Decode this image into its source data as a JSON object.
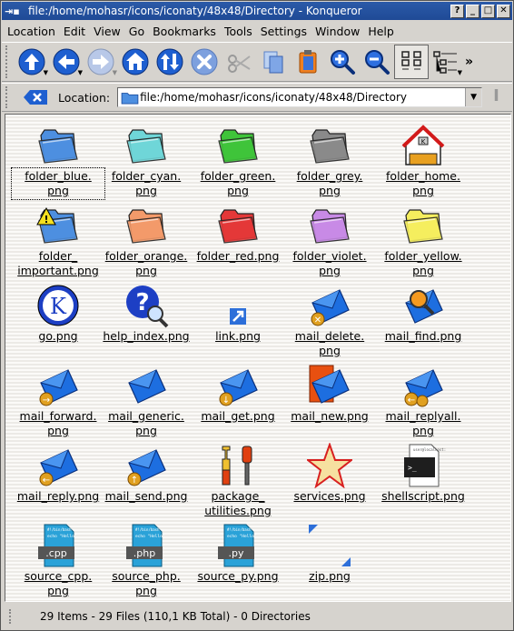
{
  "window": {
    "title": "file:/home/mohasr/icons/iconaty/48x48/Directory - Konqueror",
    "app_icon": "konqueror-icon",
    "buttons": [
      "?",
      "_",
      "□",
      "✕"
    ]
  },
  "menu": [
    "Location",
    "Edit",
    "View",
    "Go",
    "Bookmarks",
    "Tools",
    "Settings",
    "Window",
    "Help"
  ],
  "toolbar": {
    "buttons": [
      "up-arrow-icon",
      "back-arrow-icon",
      "forward-arrow-icon",
      "home-icon",
      "reload-icon",
      "stop-icon",
      "cut-icon",
      "copy-icon",
      "paste-icon",
      "zoom-in-icon",
      "zoom-out-icon",
      "icon-view-icon",
      "tree-view-icon"
    ],
    "more": "»"
  },
  "locationbar": {
    "label": "Location:",
    "url": "file:/home/mohasr/icons/iconaty/48x48/Directory"
  },
  "files": [
    {
      "name": "folder_blue.\npng",
      "icon": "folder-blue-icon",
      "color": "#4d8fe0"
    },
    {
      "name": "folder_cyan.\npng",
      "icon": "folder-cyan-icon",
      "color": "#6fd6d8"
    },
    {
      "name": "folder_green.\npng",
      "icon": "folder-green-icon",
      "color": "#3fc43a"
    },
    {
      "name": "folder_grey.\npng",
      "icon": "folder-grey-icon",
      "color": "#8a8a8a"
    },
    {
      "name": "folder_home.\npng",
      "icon": "folder-home-icon",
      "color": "#d21a1a"
    },
    {
      "name": "folder_\nimportant.png",
      "icon": "folder-important-icon",
      "color": "#4d8fe0"
    },
    {
      "name": "folder_orange.\npng",
      "icon": "folder-orange-icon",
      "color": "#f39a6a"
    },
    {
      "name": "folder_red.png",
      "icon": "folder-red-icon",
      "color": "#e43838"
    },
    {
      "name": "folder_violet.\npng",
      "icon": "folder-violet-icon",
      "color": "#c88ae6"
    },
    {
      "name": "folder_yellow.\npng",
      "icon": "folder-yellow-icon",
      "color": "#f5ee5e"
    },
    {
      "name": "go.png",
      "icon": "kde-go-icon",
      "color": "#1d3fc4"
    },
    {
      "name": "help_index.png",
      "icon": "help-index-icon",
      "color": "#1d3fc4"
    },
    {
      "name": "link.png",
      "icon": "link-icon",
      "color": "#2d6fd9"
    },
    {
      "name": "mail_delete.\npng",
      "icon": "mail-delete-icon",
      "color": "#1d6ee0"
    },
    {
      "name": "mail_find.png",
      "icon": "mail-find-icon",
      "color": "#1d6ee0"
    },
    {
      "name": "mail_forward.\npng",
      "icon": "mail-forward-icon",
      "color": "#1d6ee0"
    },
    {
      "name": "mail_generic.\npng",
      "icon": "mail-generic-icon",
      "color": "#1d6ee0"
    },
    {
      "name": "mail_get.png",
      "icon": "mail-get-icon",
      "color": "#1d6ee0"
    },
    {
      "name": "mail_new.png",
      "icon": "mail-new-icon",
      "color": "#1d6ee0"
    },
    {
      "name": "mail_replyall.\npng",
      "icon": "mail-replyall-icon",
      "color": "#1d6ee0"
    },
    {
      "name": "mail_reply.png",
      "icon": "mail-reply-icon",
      "color": "#1d6ee0"
    },
    {
      "name": "mail_send.png",
      "icon": "mail-send-icon",
      "color": "#1d6ee0"
    },
    {
      "name": "package_\nutilities.png",
      "icon": "package-utilities-icon",
      "color": "#e0a020"
    },
    {
      "name": "services.png",
      "icon": "services-star-icon",
      "color": "#d82020"
    },
    {
      "name": "shellscript.png",
      "icon": "shellscript-icon",
      "color": "#1e1e1e"
    },
    {
      "name": "source_cpp.\npng",
      "icon": "source-cpp-icon",
      "color": "#2aa2d8",
      "tag": ".cpp"
    },
    {
      "name": "source_php.\npng",
      "icon": "source-php-icon",
      "color": "#2aa2d8",
      "tag": ".php"
    },
    {
      "name": "source_py.png",
      "icon": "source-py-icon",
      "color": "#2aa2d8",
      "tag": ".py"
    },
    {
      "name": "zip.png",
      "icon": "zip-icon",
      "color": "#2d6fd9"
    }
  ],
  "status": "29 Items - 29 Files (110,1 KB Total) - 0 Directories"
}
